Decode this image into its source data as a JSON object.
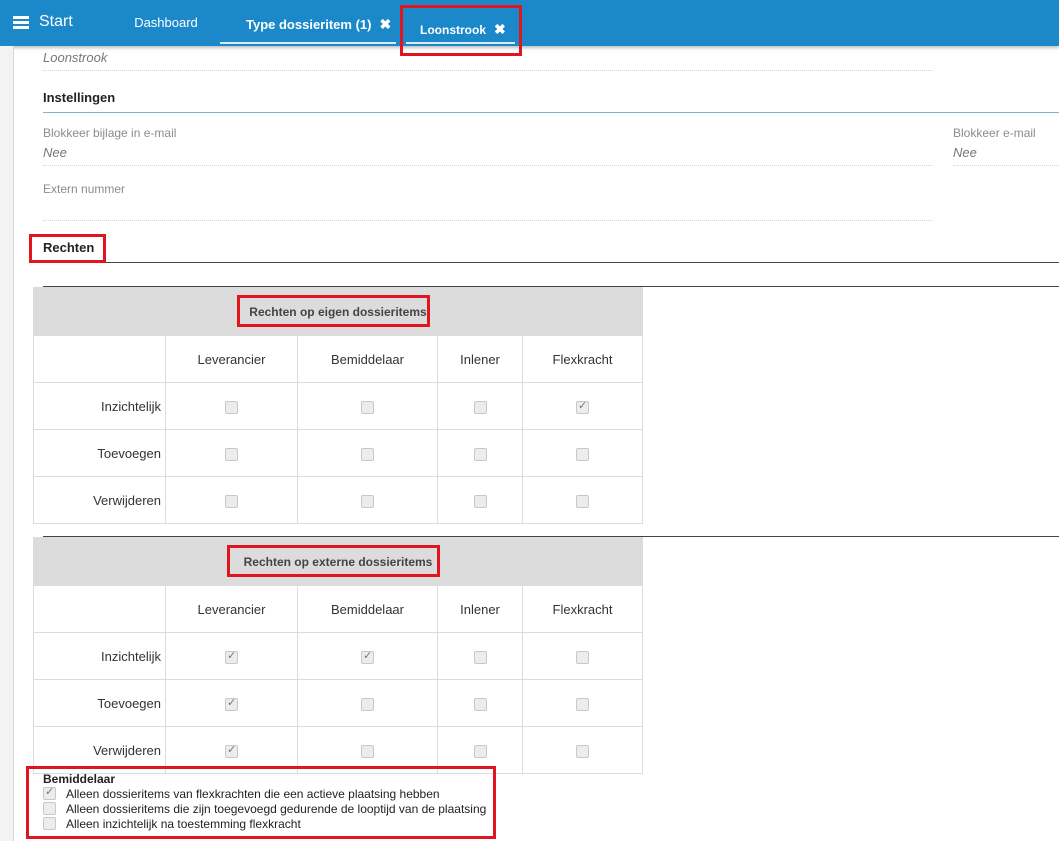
{
  "topbar": {
    "start_label": "Start",
    "tabs": [
      {
        "label": "Dashboard"
      },
      {
        "label": "Type dossieritem (1)",
        "close": "✖"
      },
      {
        "label": "Loonstrook",
        "close": "✖"
      }
    ]
  },
  "form": {
    "name_value": "Loonstrook",
    "instellingen_title": "Instellingen",
    "blokkeer_bijlage_label": "Blokkeer bijlage in e-mail",
    "blokkeer_bijlage_value": "Nee",
    "blokkeer_email_label": "Blokkeer e-mail",
    "blokkeer_email_value": "Nee",
    "extern_nummer_label": "Extern nummer",
    "rechten_title": "Rechten"
  },
  "columns": [
    "Leverancier",
    "Bemiddelaar",
    "Inlener",
    "Flexkracht"
  ],
  "tables": [
    {
      "title": "Rechten op eigen dossieritems",
      "rows": [
        {
          "label": "Inzichtelijk",
          "checks": [
            false,
            false,
            false,
            true
          ]
        },
        {
          "label": "Toevoegen",
          "checks": [
            false,
            false,
            false,
            false
          ]
        },
        {
          "label": "Verwijderen",
          "checks": [
            false,
            false,
            false,
            false
          ]
        }
      ]
    },
    {
      "title": "Rechten op externe dossieritems",
      "rows": [
        {
          "label": "Inzichtelijk",
          "checks": [
            true,
            true,
            false,
            false
          ]
        },
        {
          "label": "Toevoegen",
          "checks": [
            true,
            false,
            false,
            false
          ]
        },
        {
          "label": "Verwijderen",
          "checks": [
            true,
            false,
            false,
            false
          ]
        }
      ]
    }
  ],
  "bemiddelaar": {
    "title": "Bemiddelaar",
    "options": [
      {
        "label": "Alleen dossieritems van flexkrachten die een actieve plaatsing hebben",
        "checked": true
      },
      {
        "label": "Alleen dossieritems die zijn toegevoegd gedurende de looptijd van de plaatsing",
        "checked": false
      },
      {
        "label": "Alleen inzichtelijk na toestemming flexkracht",
        "checked": false
      }
    ]
  },
  "colors": {
    "topbar": "#1a88c9",
    "highlight": "#e0161e"
  }
}
